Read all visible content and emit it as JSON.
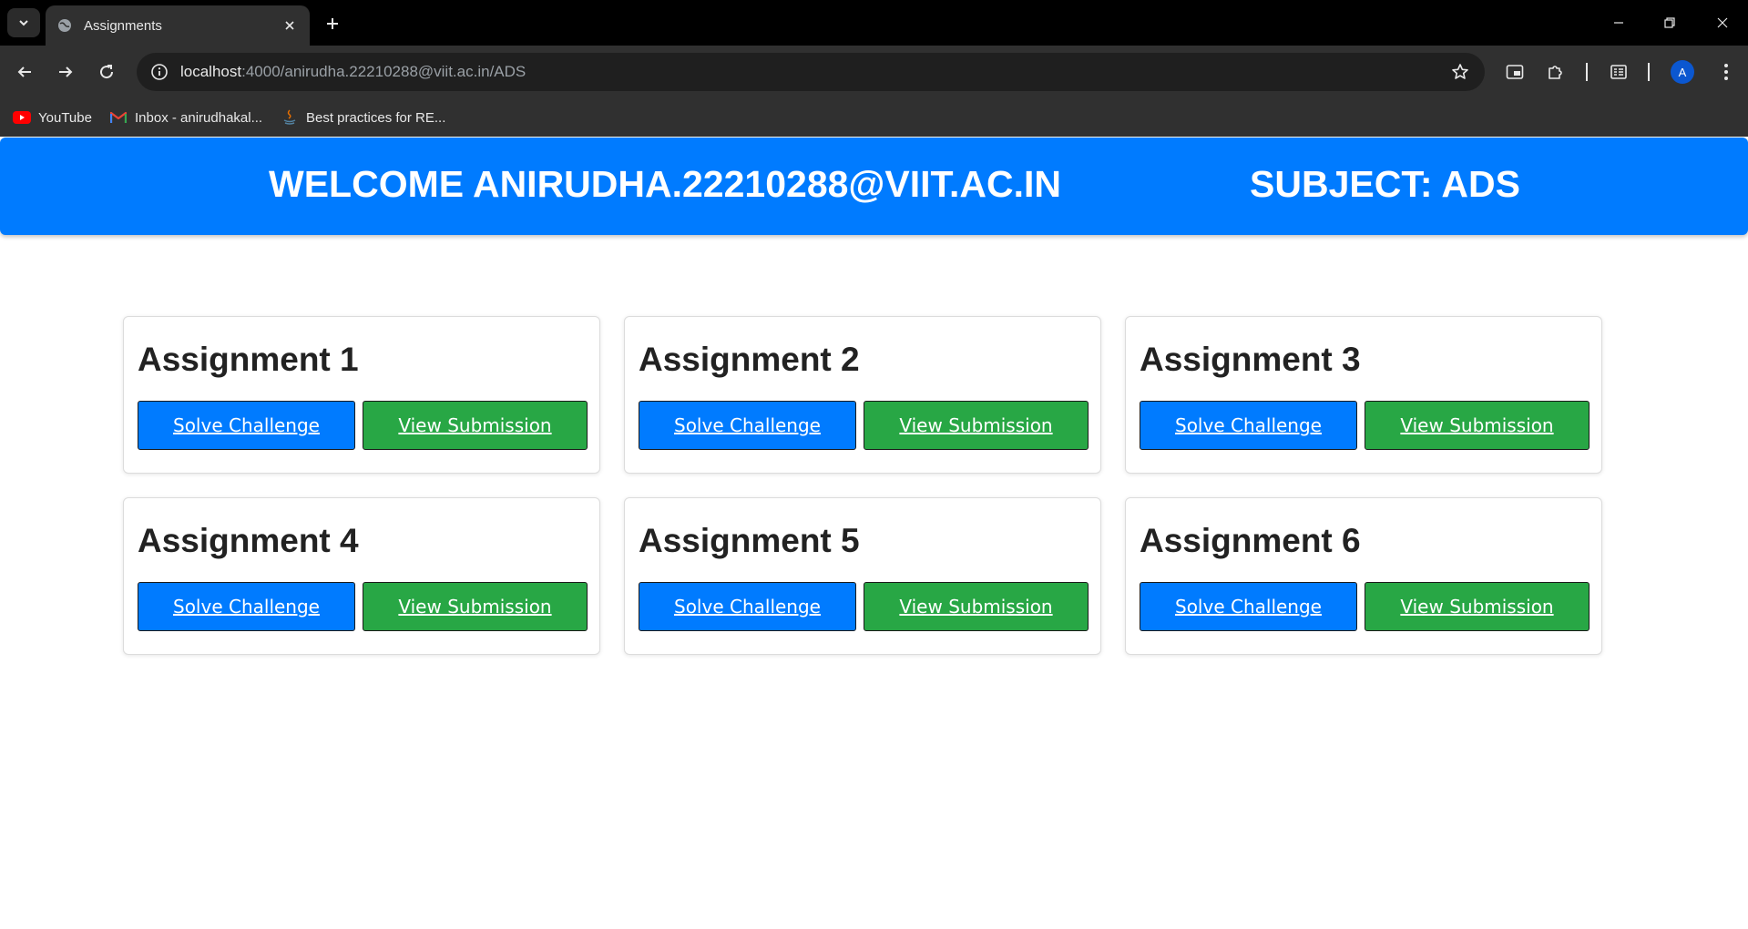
{
  "browser": {
    "tab": {
      "title": "Assignments"
    },
    "url": {
      "host": "localhost",
      "rest": ":4000/anirudha.22210288@viit.ac.in/ADS"
    },
    "profile_initial": "A",
    "bookmarks": [
      {
        "label": "YouTube",
        "icon": "youtube-icon"
      },
      {
        "label": "Inbox - anirudhakal...",
        "icon": "gmail-icon"
      },
      {
        "label": "Best practices for RE...",
        "icon": "java-icon"
      }
    ]
  },
  "header": {
    "welcome": "WELCOME ANIRUDHA.22210288@VIIT.AC.IN",
    "subject": "SUBJECT: ADS"
  },
  "assignments": [
    {
      "title": "Assignment 1",
      "solve_label": "Solve Challenge",
      "view_label": "View Submission"
    },
    {
      "title": "Assignment 2",
      "solve_label": "Solve Challenge",
      "view_label": "View Submission"
    },
    {
      "title": "Assignment 3",
      "solve_label": "Solve Challenge",
      "view_label": "View Submission"
    },
    {
      "title": "Assignment 4",
      "solve_label": "Solve Challenge",
      "view_label": "View Submission"
    },
    {
      "title": "Assignment 5",
      "solve_label": "Solve Challenge",
      "view_label": "View Submission"
    },
    {
      "title": "Assignment 6",
      "solve_label": "Solve Challenge",
      "view_label": "View Submission"
    }
  ],
  "colors": {
    "header_bg": "#007bff",
    "solve_button": "#007bff",
    "view_button": "#28a745"
  }
}
